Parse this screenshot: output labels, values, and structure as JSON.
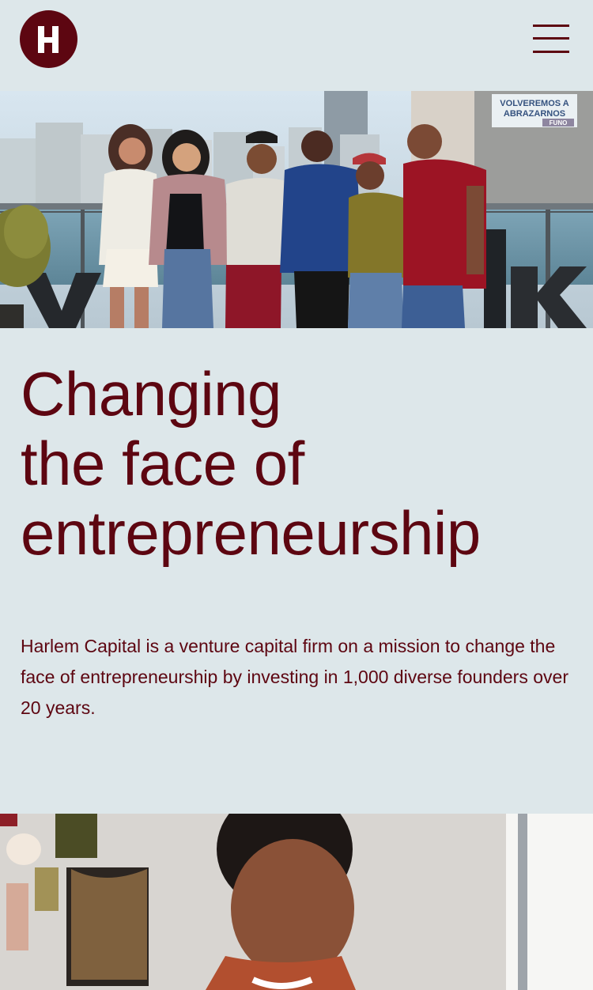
{
  "brand": {
    "name": "Harlem Capital",
    "logo_letter": "H",
    "primary_color": "#5d0611",
    "background_color": "#dde7ea"
  },
  "header": {
    "logo_icon": "logo-h-icon",
    "menu_icon": "hamburger-menu-icon"
  },
  "hero": {
    "title_line_1": "Changing",
    "title_line_2": "the face of",
    "title_line_3": "entrepreneurship",
    "description": "Harlem Capital is a venture capital firm on a mission to change the face of entrepreneurship by investing in 1,000 diverse founders over 20 years.",
    "banner_line_1": "VOLVEREMOS A",
    "banner_line_2": "ABRAZARNOS",
    "banner_line_3": "FUNO"
  }
}
